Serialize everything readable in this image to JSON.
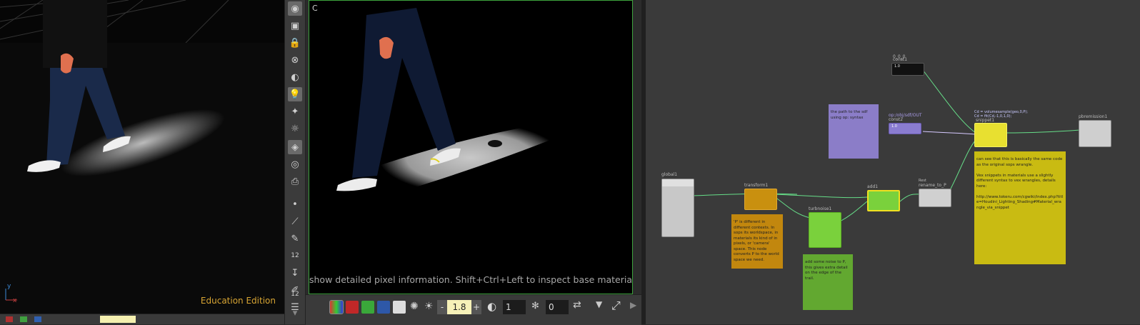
{
  "left_viewport": {
    "education_label": "Education Edition",
    "axis": {
      "y": "y",
      "x": "x"
    }
  },
  "toolshelf": {
    "tools": [
      {
        "name": "display-options-icon",
        "glyph": "◉"
      },
      {
        "name": "wireframe-icon",
        "glyph": "▣"
      },
      {
        "name": "lock-icon",
        "glyph": "🔒"
      },
      {
        "name": "clear-icon",
        "glyph": "⊗"
      },
      {
        "name": "light-view-icon",
        "glyph": "◐"
      },
      {
        "name": "light-bulb-icon",
        "glyph": "💡"
      },
      {
        "name": "add-light-icon",
        "glyph": "✦"
      },
      {
        "name": "camera-light-icon",
        "glyph": "☼"
      },
      {
        "name": "shading-icon",
        "glyph": "◈"
      },
      {
        "name": "eye-icon",
        "glyph": "◎"
      },
      {
        "name": "camera-icon",
        "glyph": "⎙"
      },
      {
        "name": "point-icon",
        "glyph": "•"
      },
      {
        "name": "edge-icon",
        "glyph": "⟋"
      },
      {
        "name": "pick-icon",
        "glyph": "✎"
      },
      {
        "name": "snap-icon",
        "glyph": "↧"
      },
      {
        "name": "brush-icon",
        "glyph": "✐"
      },
      {
        "name": "layers-icon",
        "glyph": "☰"
      },
      {
        "name": "scroll-down-icon",
        "glyph": "▾"
      }
    ],
    "counter_top": "12",
    "counter_bottom": "12"
  },
  "render_view": {
    "corner_label": "C",
    "hint": "show detailed pixel information. Shift+Ctrl+Left to inspect base material in the param"
  },
  "render_toolbar": {
    "exposure_value": "1.8",
    "gamma_value": "1",
    "offset_value": "0",
    "minus_label": "-",
    "plus_label": "+"
  },
  "network": {
    "nodes": {
      "global1": "global1",
      "transform1": "transform1",
      "turbnoise1": "turbnoise1",
      "add1": "add1",
      "rename_to_P": "rename_to_P",
      "rename_sub": "Rest",
      "const1": "const1",
      "const1_sub": "0_0_0",
      "const1_val": "1.0",
      "const2": "const2",
      "const2_path": "op:/obj/sdf/OUT",
      "const2_val": "1.0",
      "snippet1": "snippet1",
      "snippet1_code1": "Cd = volumesample(geo,0,P);",
      "snippet1_code2": "Cd = fit(Cd,-1,0,1,0);",
      "pbremission1": "pbremission1"
    },
    "stickies": {
      "purple": "the path to the sdf using op: syntax",
      "orange": "'P' is different in different contexts. In sops its worldspace, in materials its kind of in pixels, or 'camera' space. This node converts P to the world space we need.",
      "green": "add some noise to P, this gives extra detail on the edge of the trail.",
      "yellow_1": "can see that this is basically the same code as the original sops wrangle.",
      "yellow_2": "Vex snippets in materials use a slightly different syntax to vex wrangles, details here:",
      "yellow_3": "http://www.tokeru.com/cgwiki/index.php?title=Houdini_Lighting_Shading#Material_wrangle_via_snippet"
    }
  },
  "colors": {
    "accent_green": "#3da33d",
    "edu_gold": "#d8a533",
    "node_yellow": "#f0e020",
    "node_green": "#7ad13c",
    "node_orange": "#c9900f",
    "node_purple": "#8a7cd0"
  }
}
